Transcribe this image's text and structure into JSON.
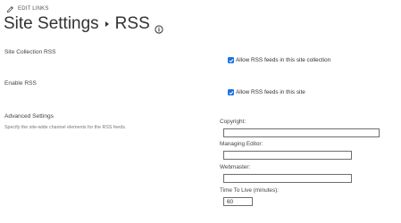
{
  "edit_links": {
    "label": "EDIT LINKS",
    "icon": "pencil-icon"
  },
  "page": {
    "breadcrumb_parent": "Site Settings",
    "breadcrumb_current": "RSS",
    "info_icon": "info-icon"
  },
  "sections": {
    "site_collection_rss": {
      "title": "Site Collection RSS",
      "checkbox_label": "Allow RSS feeds in this site collection",
      "checked": true
    },
    "enable_rss": {
      "title": "Enable RSS",
      "checkbox_label": "Allow RSS feeds in this site",
      "checked": true
    },
    "advanced_settings": {
      "title": "Advanced Settings",
      "description": "Specify the site-wide channel elements for the RSS feeds.",
      "fields": {
        "copyright": {
          "label": "Copyright:",
          "value": ""
        },
        "managing_editor": {
          "label": "Managing Editor:",
          "value": ""
        },
        "webmaster": {
          "label": "Webmaster:",
          "value": ""
        },
        "time_to_live": {
          "label": "Time To Live (minutes):",
          "value": "60"
        }
      }
    }
  },
  "colors": {
    "checkbox_fill": "#1a73e8",
    "text": "#333333",
    "input_border": "#6e6e6e"
  }
}
